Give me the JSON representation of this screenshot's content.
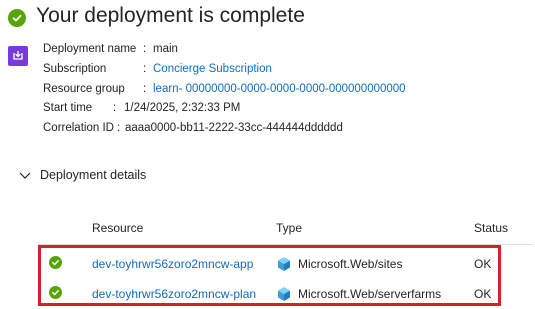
{
  "header": {
    "title": "Your deployment is complete"
  },
  "summary": {
    "deployment_name_label": "Deployment name",
    "deployment_name_value": "main",
    "subscription_label": "Subscription",
    "subscription_value": "Concierge Subscription",
    "resource_group_label": "Resource group",
    "resource_group_value": "learn- 00000000-0000-0000-0000-000000000000",
    "start_time_label": "Start time",
    "start_time_value": "1/24/2025, 2:32:33 PM",
    "correlation_id_label": "Correlation ID",
    "correlation_id_value": "aaaa0000-bb11-2222-33cc-444444dddddd",
    "separator": ":"
  },
  "details": {
    "title": "Deployment details",
    "columns": {
      "resource": "Resource",
      "type": "Type",
      "status": "Status"
    },
    "rows": [
      {
        "resource": "dev-toyhrwr56zoro2mncw-app",
        "type": "Microsoft.Web/sites",
        "status": "OK"
      },
      {
        "resource": "dev-toyhrwr56zoro2mncw-plan",
        "type": "Microsoft.Web/serverfarms",
        "status": "OK"
      }
    ]
  },
  "colors": {
    "success": "#57a300",
    "link": "#0f6cbd",
    "highlight": "#d6202a",
    "deployment_icon": "#773adc"
  },
  "icons": {
    "status": "check-circle-icon",
    "deployment": "deployment-icon",
    "expand": "chevron-down-icon",
    "resource_type": "app-service-cube-icon"
  }
}
